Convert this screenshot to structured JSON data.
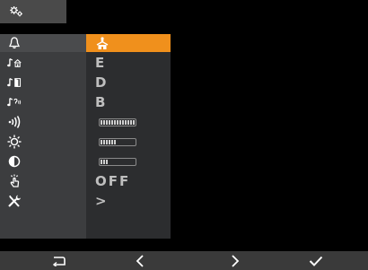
{
  "header": {
    "tab_icon": "settings-gears-icon"
  },
  "menu": {
    "selected_index": 0,
    "rows": [
      {
        "icon": "bell-icon",
        "value_type": "icon",
        "value_icon": "house-group-icon"
      },
      {
        "icon": "tone-house-icon",
        "value_type": "text",
        "value": "E"
      },
      {
        "icon": "tone-door-icon",
        "value_type": "text",
        "value": "D"
      },
      {
        "icon": "tone-intercom-icon",
        "value_type": "text",
        "value": "B"
      },
      {
        "icon": "volume-waves-icon",
        "value_type": "bar",
        "level": 1.0
      },
      {
        "icon": "brightness-icon",
        "value_type": "bar",
        "level": 0.5
      },
      {
        "icon": "contrast-icon",
        "value_type": "bar",
        "level": 0.25
      },
      {
        "icon": "touch-sound-icon",
        "value_type": "text",
        "value": "OFF"
      },
      {
        "icon": "tools-icon",
        "value_type": "text",
        "value": ">"
      }
    ]
  },
  "footer": {
    "back": "return-arrow-icon",
    "prev": "chevron-left-icon",
    "next": "chevron-right-icon",
    "confirm": "checkmark-icon"
  },
  "colors": {
    "accent": "#f0901c",
    "panel": "#3c3d3f",
    "panel_dark": "#2c2d2f",
    "footer": "#3a3a3a"
  }
}
